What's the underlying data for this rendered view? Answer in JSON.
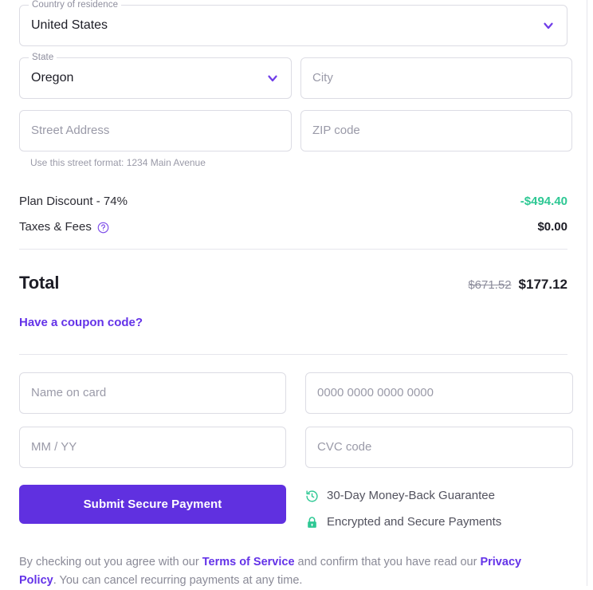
{
  "address": {
    "country": {
      "legend": "Country of residence",
      "value": "United States"
    },
    "state": {
      "legend": "State",
      "value": "Oregon"
    },
    "city": {
      "placeholder": "City"
    },
    "street": {
      "placeholder": "Street Address"
    },
    "zip": {
      "placeholder": "ZIP code"
    },
    "helper_text": "Use this street format: 1234 Main Avenue"
  },
  "summary": {
    "discount_label": "Plan Discount - 74%",
    "discount_amount": "-$494.40",
    "taxes_label": "Taxes & Fees",
    "taxes_amount": "$0.00",
    "total_label": "Total",
    "total_original": "$671.52",
    "total_final": "$177.12",
    "coupon_link": "Have a coupon code?"
  },
  "card": {
    "name_placeholder": "Name on card",
    "number_placeholder": "0000 0000 0000 0000",
    "expiry_placeholder": "MM / YY",
    "cvc_placeholder": "CVC code"
  },
  "payment": {
    "submit_label": "Submit Secure Payment",
    "badges": [
      {
        "icon": "money-back-clock-icon",
        "text": "30-Day Money-Back Guarantee"
      },
      {
        "icon": "lock-icon",
        "text": "Encrypted and Secure Payments"
      }
    ]
  },
  "legal": {
    "part1": "By checking out you agree with our ",
    "terms_link": "Terms of Service",
    "part2": " and confirm that you have read our ",
    "privacy_link": "Privacy Policy",
    "part3": ". You can cancel recurring payments at any time."
  },
  "colors": {
    "brand_purple": "#6030e0",
    "link_purple": "#6433e8",
    "success_green": "#2ec894",
    "border_gray": "#dcdce4",
    "muted_text": "#9a9aa8"
  }
}
